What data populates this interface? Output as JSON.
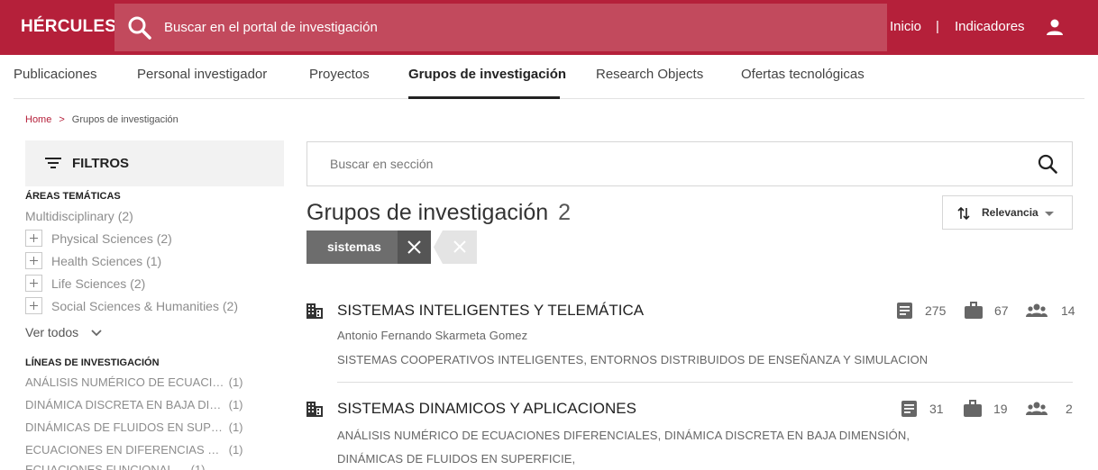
{
  "header": {
    "brand": "HÉRCULES",
    "search_placeholder": "Buscar en el portal de investigación",
    "nav_inicio": "Inicio",
    "nav_separator": "|",
    "nav_indicadores": "Indicadores",
    "bg_color": "#b5203a"
  },
  "tabs": [
    {
      "label": "Publicaciones"
    },
    {
      "label": "Personal investigador"
    },
    {
      "label": "Proyectos"
    },
    {
      "label": "Grupos de investigación",
      "active": true
    },
    {
      "label": "Research Objects"
    },
    {
      "label": "Ofertas tecnológicas"
    }
  ],
  "breadcrumb": {
    "home": "Home",
    "separator": ">",
    "current": "Grupos de investigación"
  },
  "sidebar": {
    "filters_title": "FILTROS",
    "areas_title": "ÁREAS TEMÁTICAS",
    "areas": [
      {
        "label": "Multidisciplinary",
        "count": "(2)"
      },
      {
        "label": "Physical Sciences",
        "count": "(2)"
      },
      {
        "label": "Health Sciences",
        "count": "(1)"
      },
      {
        "label": "Life Sciences",
        "count": "(2)"
      },
      {
        "label": "Social Sciences & Humanities",
        "count": "(2)"
      }
    ],
    "ver_todos": "Ver todos",
    "lineas_title": "LÍNEAS DE INVESTIGACIÓN",
    "lineas": [
      {
        "label": "ANÁLISIS NUMÉRICO DE ECUACIONES DIFERENCIALES",
        "count": "(1)"
      },
      {
        "label": "DINÁMICA DISCRETA EN BAJA DIMENSIÓN",
        "count": "(1)"
      },
      {
        "label": "DINÁMICAS DE FLUIDOS EN SUPERFICIE",
        "count": "(1)"
      },
      {
        "label": "ECUACIONES EN DIFERENCIAS NO LINEALES",
        "count": "(1)"
      },
      {
        "label": "ECUACIONES FUNCIONALES",
        "count": "(1)"
      }
    ]
  },
  "main": {
    "section_search_placeholder": "Buscar en sección",
    "title": "Grupos de investigación",
    "count": "2",
    "sort_label": "Relevancia",
    "active_filter": "sistemas",
    "results": [
      {
        "title": "SISTEMAS INTELIGENTES Y TELEMÁTICA",
        "person": "Antonio Fernando Skarmeta Gomez",
        "tags": "SISTEMAS COOPERATIVOS INTELIGENTES,   ENTORNOS DISTRIBUIDOS DE ENSEÑANZA Y SIMULACION",
        "publications": "275",
        "projects": "67",
        "members": "14"
      },
      {
        "title": "SISTEMAS DINAMICOS Y APLICACIONES",
        "tags": "ANÁLISIS NUMÉRICO DE ECUACIONES DIFERENCIALES,   DINÁMICA DISCRETA EN BAJA DIMENSIÓN,",
        "tags2": "DINÁMICAS DE FLUIDOS EN SUPERFICIE,",
        "publications": "31",
        "projects": "19",
        "members": "2"
      }
    ]
  }
}
